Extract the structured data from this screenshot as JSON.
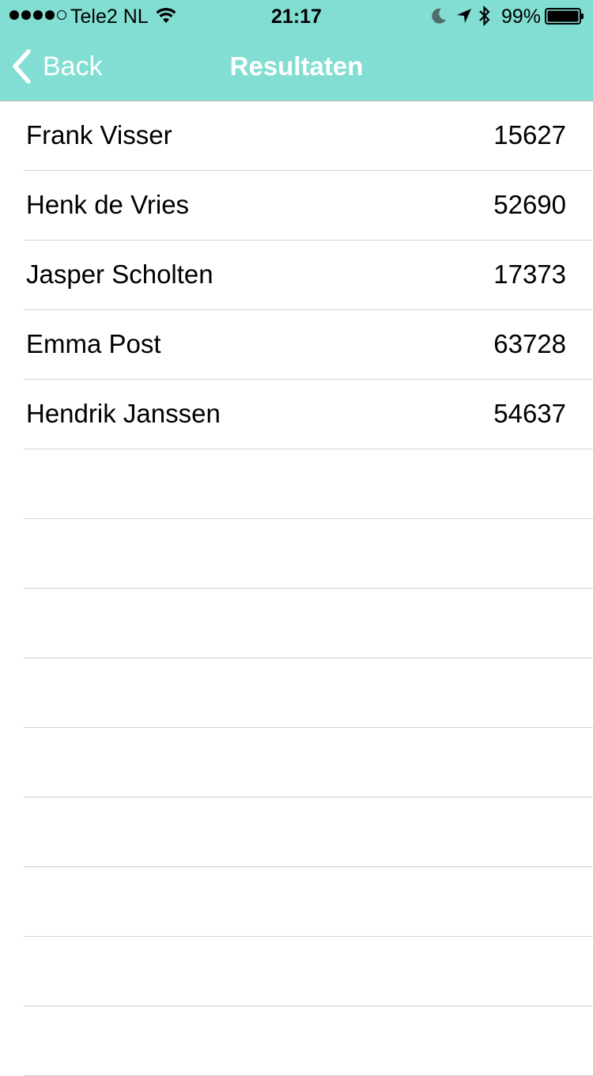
{
  "status_bar": {
    "carrier": "Tele2 NL",
    "time": "21:17",
    "battery_percent": "99%",
    "signal_bars_filled": 4,
    "signal_bars_total": 5,
    "icons": [
      "signal-icon",
      "wifi-icon",
      "moon-icon",
      "location-icon",
      "bluetooth-icon",
      "battery-icon"
    ]
  },
  "nav": {
    "back_label": "Back",
    "title": "Resultaten",
    "background_color": "#82ded2",
    "tint_color": "#ffffff"
  },
  "results": [
    {
      "name": "Frank Visser",
      "score": "15627"
    },
    {
      "name": "Henk de Vries",
      "score": "52690"
    },
    {
      "name": "Jasper Scholten",
      "score": "17373"
    },
    {
      "name": "Emma Post",
      "score": "63728"
    },
    {
      "name": "Hendrik Janssen",
      "score": "54637"
    }
  ],
  "empty_row_count": 9
}
